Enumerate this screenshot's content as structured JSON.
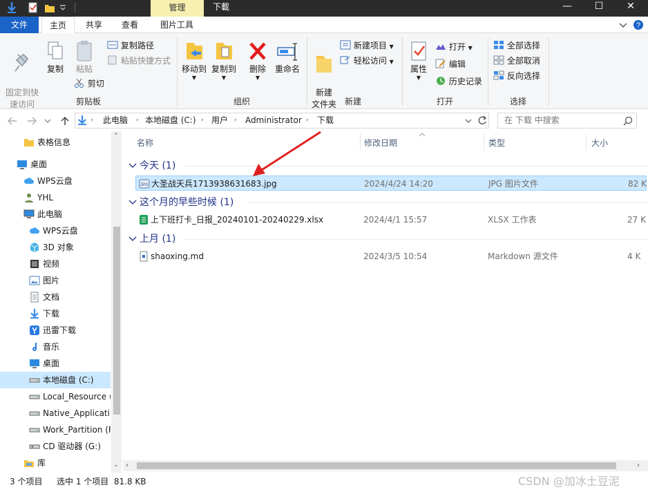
{
  "titlebar": {
    "context_tab": "管理",
    "title": "下載",
    "minimize": "—",
    "maximize": "☐",
    "close": "✕"
  },
  "tabs": [
    "文件",
    "主页",
    "共享",
    "查看",
    "图片工具"
  ],
  "ribbon": {
    "clipboard": {
      "pin": "固定到快\n速访问",
      "copy": "复制",
      "paste": "粘贴",
      "copy_path": "复制路径",
      "paste_shortcut": "粘贴快捷方式",
      "cut": "剪切",
      "group": "剪贴板"
    },
    "organize": {
      "move_to": "移动到",
      "copy_to": "复制到",
      "delete": "删除",
      "rename": "重命名",
      "group": "组织"
    },
    "new": {
      "new_folder": "新建\n文件夹",
      "new_item": "新建项目",
      "easy_access": "轻松访问",
      "group": "新建"
    },
    "open": {
      "properties": "属性",
      "open": "打开",
      "edit": "编辑",
      "history": "历史记录",
      "group": "打开"
    },
    "select": {
      "select_all": "全部选择",
      "select_none": "全部取消",
      "invert": "反向选择",
      "group": "选择"
    }
  },
  "address": {
    "crumbs": [
      "此电脑",
      "本地磁盘 (C:)",
      "用户",
      "Administrator",
      "下载"
    ],
    "search_placeholder": "在 下载 中搜索"
  },
  "nav_items": [
    {
      "label": "表格信息",
      "icon": "folder-icon"
    },
    {
      "label": "桌面",
      "icon": "desktop-icon"
    },
    {
      "label": "WPS云盘",
      "icon": "cloud-icon"
    },
    {
      "label": "YHL",
      "icon": "user-icon"
    },
    {
      "label": "此电脑",
      "icon": "computer-icon"
    },
    {
      "label": "WPS云盘",
      "icon": "cloud-icon"
    },
    {
      "label": "3D 对象",
      "icon": "cube-icon"
    },
    {
      "label": "视频",
      "icon": "video-icon"
    },
    {
      "label": "图片",
      "icon": "picture-icon"
    },
    {
      "label": "文档",
      "icon": "document-icon"
    },
    {
      "label": "下载",
      "icon": "download-icon"
    },
    {
      "label": "迅雷下载",
      "icon": "thunder-icon"
    },
    {
      "label": "音乐",
      "icon": "music-icon"
    },
    {
      "label": "桌面",
      "icon": "desktop-icon"
    },
    {
      "label": "本地磁盘 (C:)",
      "icon": "drive-icon"
    },
    {
      "label": "Local_Resource (",
      "icon": "drive-icon"
    },
    {
      "label": "Native_Applicati",
      "icon": "drive-icon"
    },
    {
      "label": "Work_Partition (F",
      "icon": "drive-icon"
    },
    {
      "label": "CD 驱动器 (G:)",
      "icon": "cd-icon"
    },
    {
      "label": "库",
      "icon": "library-icon"
    }
  ],
  "columns": {
    "name": "名称",
    "date": "修改日期",
    "type": "类型",
    "size": "大小"
  },
  "groups": [
    {
      "label": "今天 (1)",
      "files": [
        {
          "name": "大圣战天兵1713938631683.jpg",
          "date": "2024/4/24 14:20",
          "type": "JPG 图片文件",
          "size": "82 K"
        }
      ]
    },
    {
      "label": "这个月的早些时候 (1)",
      "files": [
        {
          "name": "上下班打卡_日报_20240101-20240229.xlsx",
          "date": "2024/4/1 15:57",
          "type": "XLSX 工作表",
          "size": "27 K"
        }
      ]
    },
    {
      "label": "上月 (1)",
      "files": [
        {
          "name": "shaoxing.md",
          "date": "2024/3/5 10:54",
          "type": "Markdown 源文件",
          "size": "4 K"
        }
      ]
    }
  ],
  "status": {
    "count": "3 个项目",
    "selection": "选中 1 个项目  81.8 KB"
  },
  "watermark": "CSDN @加冰土豆泥",
  "colors": {
    "accent": "#1a63c7",
    "selection": "#cce8ff",
    "group_text": "#1e3287",
    "annotation_arrow": "#e02020"
  }
}
